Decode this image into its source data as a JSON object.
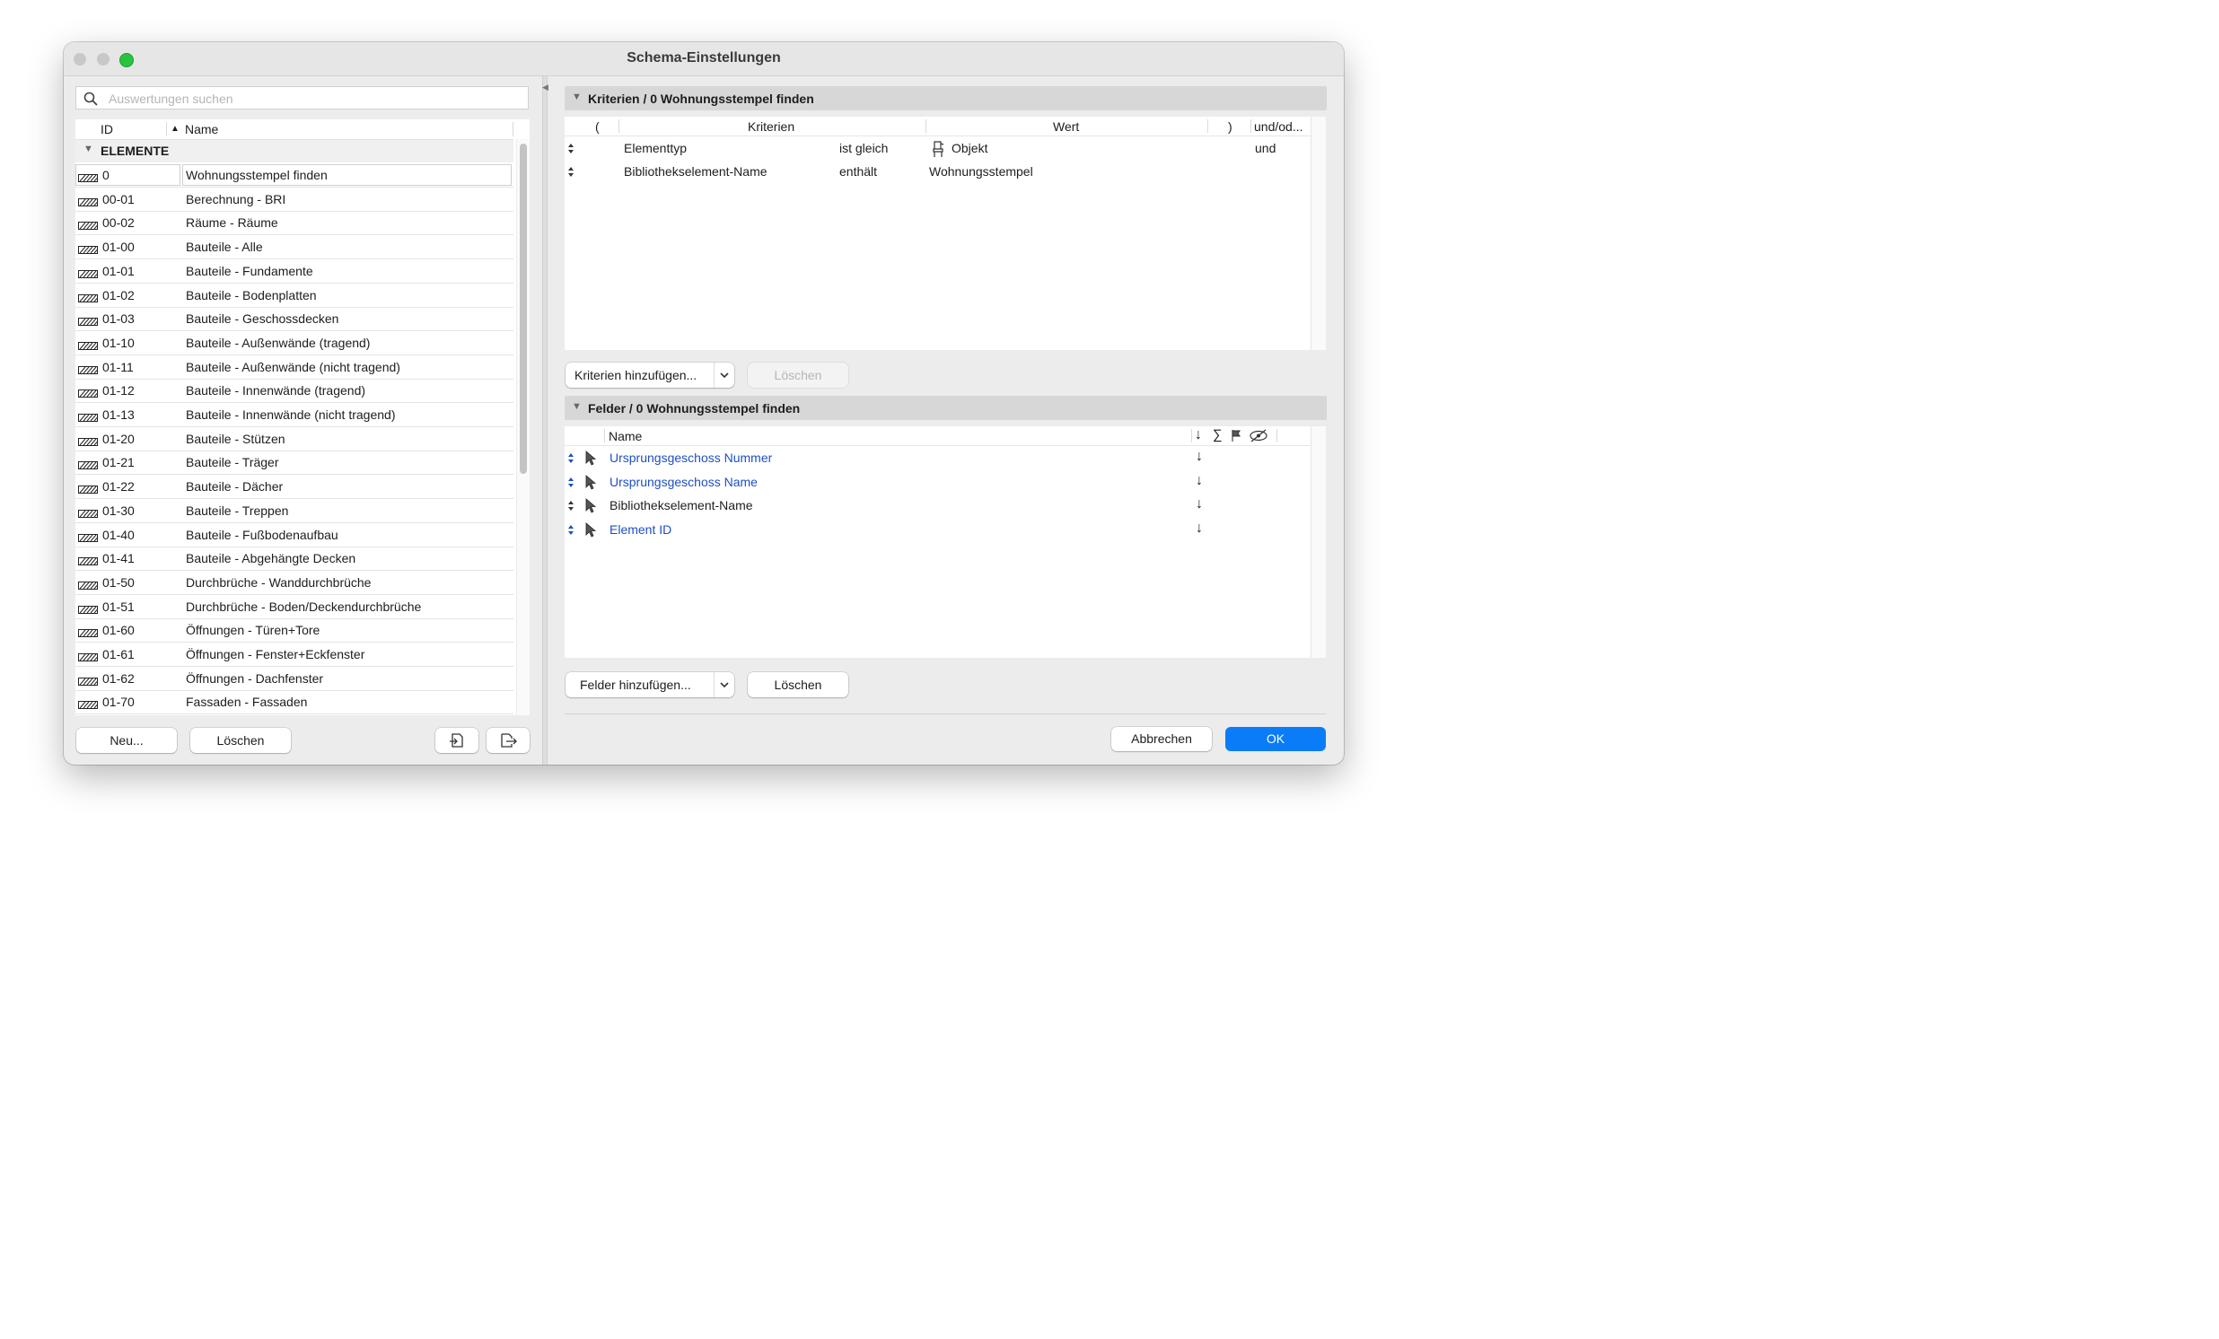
{
  "window": {
    "title": "Schema-Einstellungen"
  },
  "search": {
    "placeholder": "Auswertungen suchen"
  },
  "list": {
    "col_id": "ID",
    "col_name": "Name",
    "group": "ELEMENTE",
    "rows": [
      {
        "id": "0",
        "name": "Wohnungsstempel finden",
        "selected": true
      },
      {
        "id": "00-01",
        "name": "Berechnung - BRI"
      },
      {
        "id": "00-02",
        "name": "Räume - Räume"
      },
      {
        "id": "01-00",
        "name": "Bauteile - Alle"
      },
      {
        "id": "01-01",
        "name": "Bauteile - Fundamente"
      },
      {
        "id": "01-02",
        "name": "Bauteile - Bodenplatten"
      },
      {
        "id": "01-03",
        "name": "Bauteile - Geschossdecken"
      },
      {
        "id": "01-10",
        "name": "Bauteile - Außenwände (tragend)"
      },
      {
        "id": "01-11",
        "name": "Bauteile - Außenwände (nicht tragend)"
      },
      {
        "id": "01-12",
        "name": "Bauteile - Innenwände (tragend)"
      },
      {
        "id": "01-13",
        "name": "Bauteile - Innenwände (nicht tragend)"
      },
      {
        "id": "01-20",
        "name": "Bauteile - Stützen"
      },
      {
        "id": "01-21",
        "name": "Bauteile - Träger"
      },
      {
        "id": "01-22",
        "name": "Bauteile - Dächer"
      },
      {
        "id": "01-30",
        "name": "Bauteile - Treppen"
      },
      {
        "id": "01-40",
        "name": "Bauteile - Fußbodenaufbau"
      },
      {
        "id": "01-41",
        "name": "Bauteile - Abgehängte Decken"
      },
      {
        "id": "01-50",
        "name": "Durchbrüche - Wanddurchbrüche"
      },
      {
        "id": "01-51",
        "name": "Durchbrüche - Boden/Deckendurchbrüche"
      },
      {
        "id": "01-60",
        "name": "Öffnungen - Türen+Tore"
      },
      {
        "id": "01-61",
        "name": "Öffnungen - Fenster+Eckfenster"
      },
      {
        "id": "01-62",
        "name": "Öffnungen - Dachfenster"
      },
      {
        "id": "01-70",
        "name": "Fassaden - Fassaden"
      }
    ]
  },
  "left_buttons": {
    "new": "Neu...",
    "delete": "Löschen"
  },
  "criteria": {
    "header": "Kriterien / 0 Wohnungsstempel finden",
    "col_open": "(",
    "col_criteria": "Kriterien",
    "col_value": "Wert",
    "col_close": ")",
    "col_andor": "und/od...",
    "rows": [
      {
        "criterion": "Elementtyp",
        "operator": "ist gleich",
        "value": "Objekt",
        "andor": "und",
        "has_icon": true
      },
      {
        "criterion": "Bibliothekselement-Name",
        "operator": "enthält",
        "value": "Wohnungsstempel",
        "andor": ""
      }
    ],
    "add_button": "Kriterien hinzufügen...",
    "delete_button": "Löschen"
  },
  "fields": {
    "header": "Felder / 0 Wohnungsstempel finden",
    "col_name": "Name",
    "col_icons": [
      "sort-down-icon",
      "sum-icon",
      "flag-icon",
      "hidden-eye-icon"
    ],
    "rows": [
      {
        "name": "Ursprungsgeschoss Nummer",
        "linked": true
      },
      {
        "name": "Ursprungsgeschoss Name",
        "linked": true
      },
      {
        "name": "Bibliothekselement-Name",
        "linked": false
      },
      {
        "name": "Element ID",
        "linked": true
      }
    ],
    "add_button": "Felder hinzufügen...",
    "delete_button": "Löschen"
  },
  "footer": {
    "cancel": "Abbrechen",
    "ok": "OK"
  },
  "colors": {
    "accent": "#0a7cf8",
    "link": "#1e4fc4",
    "close_zoom": "#29c33f"
  }
}
